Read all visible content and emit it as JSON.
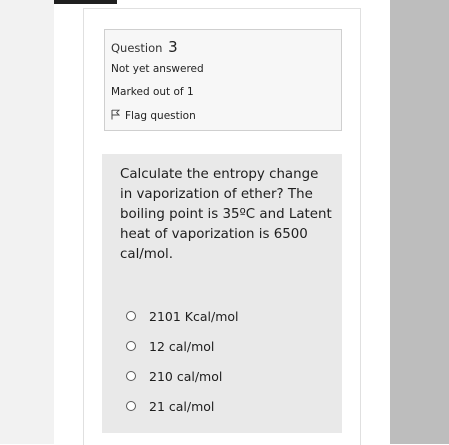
{
  "question_info": {
    "question_label": "Question",
    "question_number": "3",
    "status": "Not yet answered",
    "marks": "Marked out of 1",
    "flag_label": "Flag question"
  },
  "question": {
    "text": "Calculate the entropy change in vaporization of ether? The boiling point is 35ºC and Latent heat of vaporization is 6500 cal/mol.",
    "options": [
      {
        "label": "2101 Kcal/mol"
      },
      {
        "label": "12 cal/mol"
      },
      {
        "label": "210 cal/mol"
      },
      {
        "label": "21 cal/mol"
      }
    ]
  },
  "colors": {
    "info_background": "#f7f7f7",
    "content_background": "#e9e9e9",
    "right_sidebar": "#bdbdbd"
  }
}
